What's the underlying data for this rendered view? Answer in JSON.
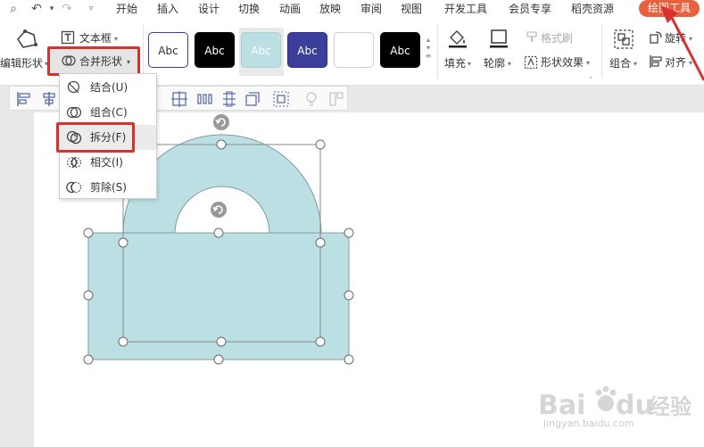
{
  "menubar": {
    "tabs": [
      "开始",
      "插入",
      "设计",
      "切换",
      "动画",
      "放映",
      "审阅",
      "视图",
      "开发工具",
      "会员专享",
      "稻壳资源"
    ],
    "active_tab": "绘图工具"
  },
  "ribbon": {
    "edit_shape": "编辑形状",
    "text_box": "文本框",
    "merge_shape": "合并形状",
    "style_swatches": [
      "Abc",
      "Abc",
      "Abc",
      "Abc",
      "",
      "Abc"
    ],
    "fill": "填充",
    "outline": "轮廓",
    "format_painter": "格式刷",
    "shape_effects": "形状效果",
    "group": "组合",
    "rotate": "旋转",
    "align": "对齐"
  },
  "dropdown": {
    "items": [
      "结合(U)",
      "组合(C)",
      "拆分(F)",
      "相交(I)",
      "剪除(S)"
    ]
  },
  "watermark": {
    "url": "jingyan.baidu.com"
  },
  "colors": {
    "accent": "#e8613c",
    "highlight": "#d6302f",
    "shape_fill": "#bcdfe3",
    "shape_stroke": "#7f9c9f"
  }
}
